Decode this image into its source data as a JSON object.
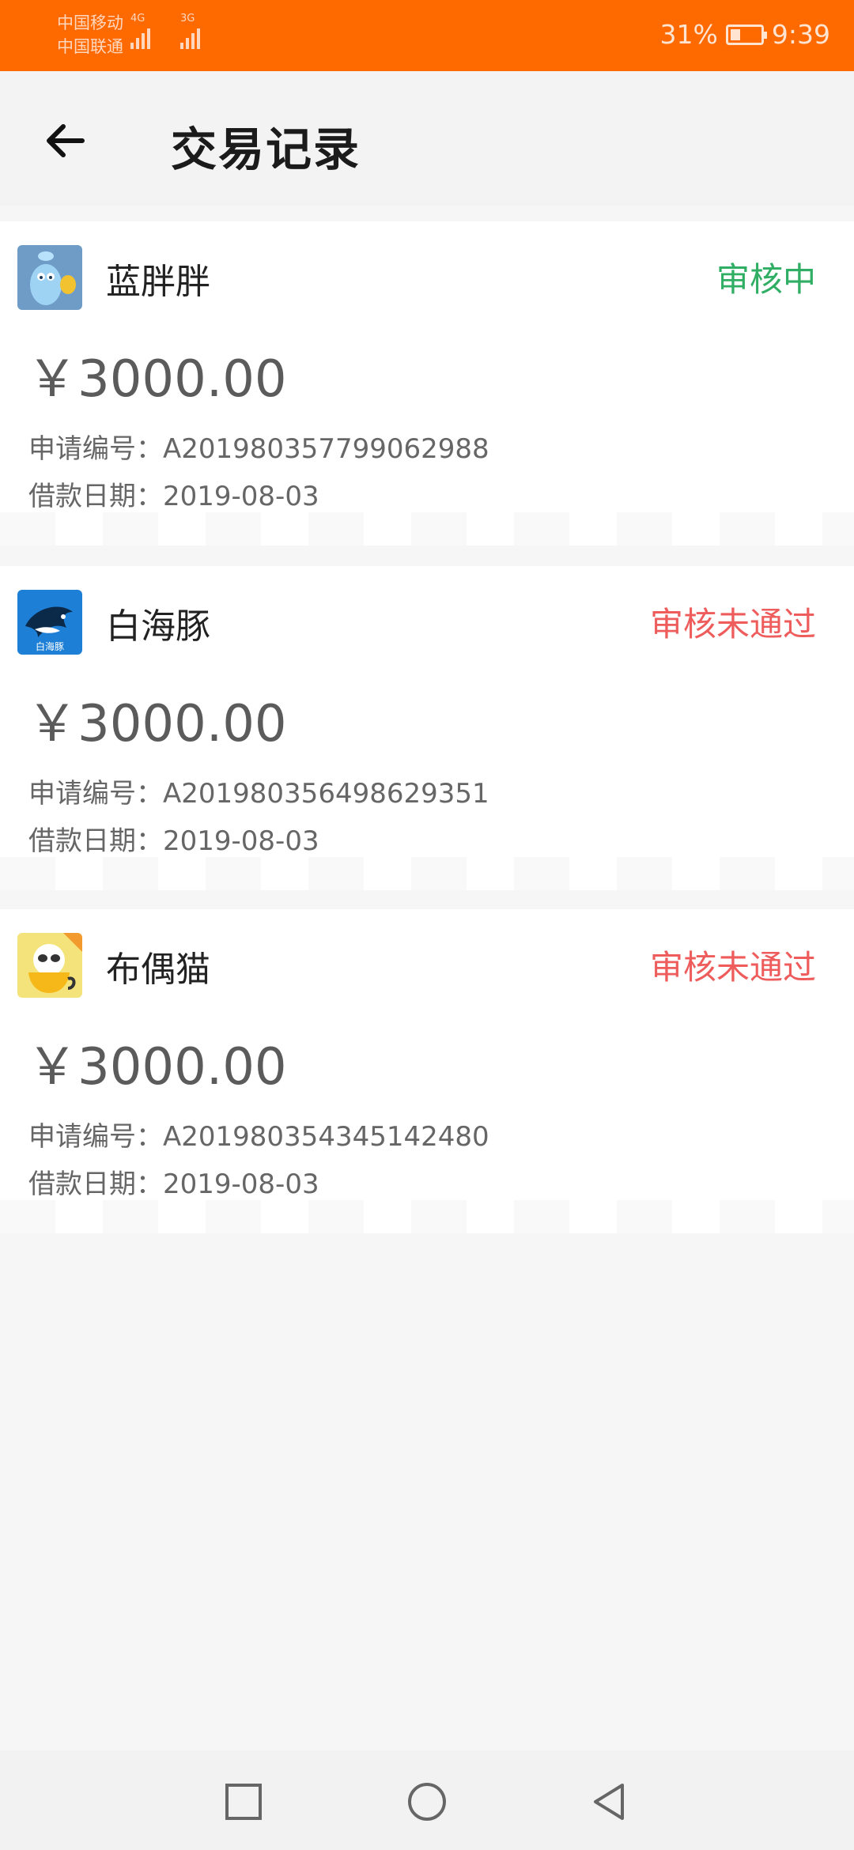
{
  "status_bar": {
    "carrier1": "中国移动",
    "carrier2": "中国联通",
    "net1": "4G",
    "net2": "3G",
    "battery": "31%",
    "time": "9:39"
  },
  "header": {
    "title": "交易记录"
  },
  "records": [
    {
      "name": "蓝胖胖",
      "status": "审核中",
      "status_color": "#2fae64",
      "amount": "￥3000.00",
      "app_no_label": "申请编号：",
      "app_no": "A201980357799062988",
      "date_label": "借款日期：",
      "date": "2019-08-03",
      "icon": "blue-mascot-logo"
    },
    {
      "name": "白海豚",
      "status": "审核未通过",
      "status_color": "#ee5c5c",
      "amount": "￥3000.00",
      "app_no_label": "申请编号：",
      "app_no": "A201980356498629351",
      "date_label": "借款日期：",
      "date": "2019-08-03",
      "icon": "dolphin-logo",
      "logo_text": "白海豚"
    },
    {
      "name": "布偶猫",
      "status": "审核未通过",
      "status_color": "#ee5c5c",
      "amount": "￥3000.00",
      "app_no_label": "申请编号：",
      "app_no": "A201980354345142480",
      "date_label": "借款日期：",
      "date": "2019-08-03",
      "icon": "cat-logo"
    }
  ],
  "nav": {
    "recent_icon": "square-icon",
    "home_icon": "circle-icon",
    "back_icon": "triangle-back-icon"
  }
}
